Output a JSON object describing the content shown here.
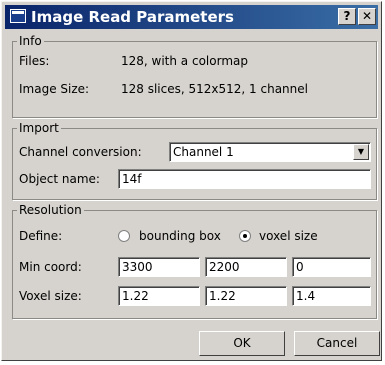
{
  "window": {
    "title": "Image Read Parameters",
    "help_label": "?",
    "close_label": "✕"
  },
  "info": {
    "legend": "Info",
    "files_label": "Files:",
    "files_value": "128, with a colormap",
    "size_label": "Image Size:",
    "size_value": "128 slices, 512x512, 1 channel"
  },
  "import": {
    "legend": "Import",
    "channel_label": "Channel conversion:",
    "channel_value": "Channel 1",
    "object_label": "Object name:",
    "object_value": "14f"
  },
  "resolution": {
    "legend": "Resolution",
    "define_label": "Define:",
    "define_options": [
      "bounding box",
      "voxel size"
    ],
    "define_selected": "voxel size",
    "min_label": "Min coord:",
    "min_values": [
      "3300",
      "2200",
      "0"
    ],
    "voxel_label": "Voxel size:",
    "voxel_values": [
      "1.22",
      "1.22",
      "1.4"
    ]
  },
  "buttons": {
    "ok": "OK",
    "cancel": "Cancel"
  }
}
